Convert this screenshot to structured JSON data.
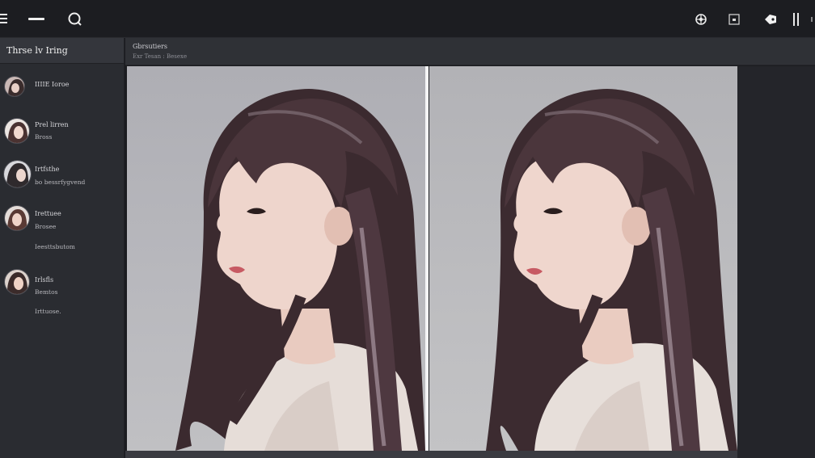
{
  "app": {
    "sidebar_title": "Thrse lv Iring"
  },
  "header": {
    "title": "Gbrsutiers",
    "subtitle": "Exr Tesan : Besexe"
  },
  "sidebar": {
    "items": [
      {
        "label": "IIIIE Ioroe",
        "sub": ""
      },
      {
        "label": "Prel lirren",
        "sub": "Bross"
      },
      {
        "label": "Irtfsthe",
        "sub": "bo bessrfygvend"
      },
      {
        "label": "Irettuee",
        "sub": "Brosee",
        "extra": "Ieesttsbutom"
      },
      {
        "label": "Irlsfls",
        "sub": "Bemtos",
        "extra": "Irttuose."
      }
    ]
  },
  "colors": {
    "topbar": "#1c1d21",
    "sidebar": "#2a2c31",
    "panel_bg": "#b8b8bd",
    "divider": "#f4f4f6"
  },
  "icons": [
    "menu-icon",
    "minus-icon",
    "search-icon",
    "settings-icon",
    "frame-icon",
    "tag-icon",
    "pause-icon"
  ]
}
